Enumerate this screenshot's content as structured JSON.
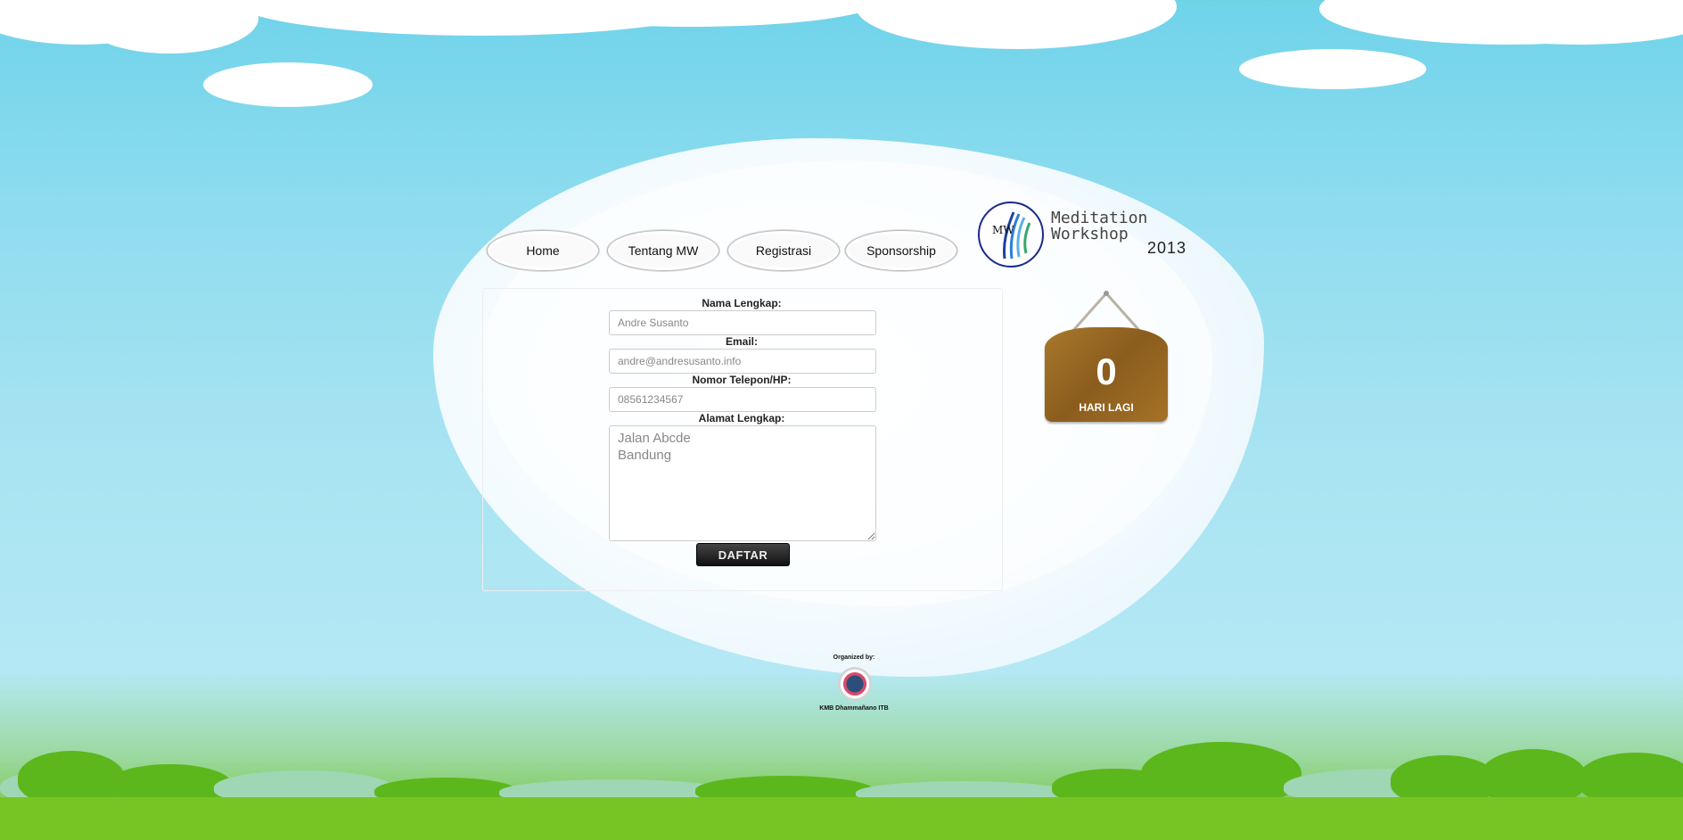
{
  "nav": {
    "items": [
      "Home",
      "Tentang MW",
      "Registrasi",
      "Sponsorship"
    ]
  },
  "logo": {
    "title_line1": "Meditation",
    "title_line2": "Workshop",
    "year": "2013"
  },
  "form": {
    "name_label": "Nama Lengkap:",
    "name_value": "Andre Susanto",
    "email_label": "Email:",
    "email_value": "andre@andresusanto.info",
    "phone_label": "Nomor Telepon/HP:",
    "phone_value": "08561234567",
    "address_label": "Alamat Lengkap:",
    "address_value": "Jalan Abcde\nBandung",
    "submit_label": "DAFTAR"
  },
  "countdown": {
    "value": "0",
    "label": "HARI LAGI"
  },
  "footer": {
    "organized_by": "Organized by:",
    "organizer": "KMB Dhammañano ITB"
  }
}
